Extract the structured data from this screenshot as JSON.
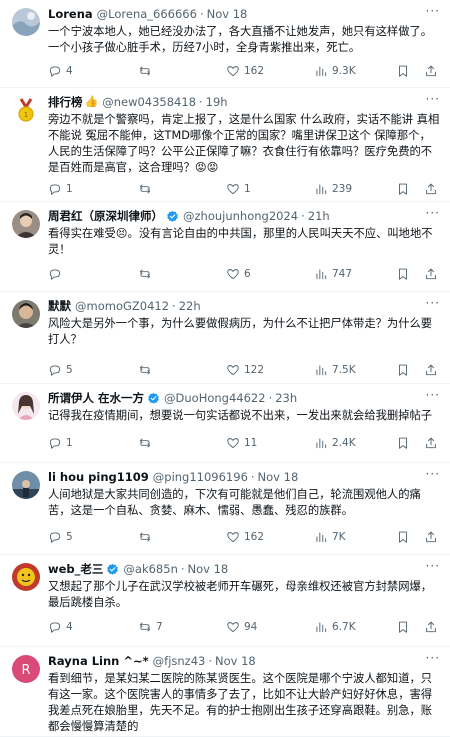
{
  "colors": {
    "verified": "#1d9bf0",
    "text": "#0f1419",
    "secondary": "#536471"
  },
  "tweets": [
    {
      "name": "Lorena",
      "handle": "@Lorena_666666",
      "time": "Nov 18",
      "text": "一个宁波本地人，她已经没办法了，各大直播不让她发声，她只有这样做了。一个小孩子做心脏手术，历经7小时，全身青紫推出来，死亡。",
      "reply": "4",
      "retweet": "",
      "like": "162",
      "views": "9.3K"
    },
    {
      "name": "排行榜",
      "emoji": "👍",
      "handle": "@new04358418",
      "time": "19h",
      "text": "旁边不就是个警察吗，肯定上报了，这是什么国家 什么政府，实话不能讲 真相不能说 冤屈不能伸，这TMD哪像个正常的国家？嘴里讲保卫这个 保障那个，人民的生活保障了吗？公平公正保障了嘛？衣食住行有依靠吗？医疗免费的不是百姓而是高官，这合理吗？😡😡",
      "reply": "1",
      "retweet": "",
      "like": "1",
      "views": "239"
    },
    {
      "name": "周君红（原深圳律师）",
      "verified": true,
      "handle": "@zhoujunhong2024",
      "time": "21h",
      "text": "看得实在难受😣。没有言论自由的中共国，那里的人民叫天天不应、叫地地不灵！",
      "reply": "",
      "retweet": "",
      "like": "6",
      "views": "747"
    },
    {
      "name": "默默",
      "handle": "@momoGZ0412",
      "time": "22h",
      "text": "风险大是另外一个事，为什么要做假病历，为什么不让把尸体带走？为什么要打人？",
      "reply": "5",
      "retweet": "",
      "like": "122",
      "views": "7.5K"
    },
    {
      "name": "所谓伊人 在水一方",
      "verified": true,
      "handle": "@DuoHong44622",
      "time": "23h",
      "text": "记得我在疫情期间，想要说一句实话都说不出来，一发出来就会给我删掉帖子",
      "reply": "1",
      "retweet": "",
      "like": "11",
      "views": "2.4K"
    },
    {
      "name": "li hou ping1109",
      "handle": "@ping11096196",
      "time": "Nov 18",
      "text": "人间地狱是大家共同创造的，下次有可能就是他们自己，轮流围观他人的痛苦，这是一个自私、贪婪、麻木、懦弱、愚蠢、残忍的族群。",
      "reply": "5",
      "retweet": "",
      "like": "162",
      "views": "7K"
    },
    {
      "name": "web_老三",
      "verified": true,
      "handle": "@ak685n",
      "time": "Nov 18",
      "text": "又想起了那个儿子在武汉学校被老师开车碾死，母亲维权还被官方封禁网爆，最后跳楼自杀。",
      "reply": "4",
      "retweet": "7",
      "like": "94",
      "views": "6.7K"
    },
    {
      "name": "Rayna Linn ^~*",
      "handle": "@fjsnz43",
      "time": "Nov 18",
      "avatar_letter": "R",
      "text": "看到细节，是某妇某二医院的陈某贤医生。这个医院是哪个宁波人都知道，只有这一家。这个医院害人的事情多了去了，比如不让大龄产妇好好休息，害得我差点死在娘胎里，先天不足。有的护士抱刚出生孩子还穿高跟鞋。别急，账都会慢慢算清楚的",
      "reply": "",
      "retweet": "",
      "like": "",
      "views": ""
    }
  ]
}
